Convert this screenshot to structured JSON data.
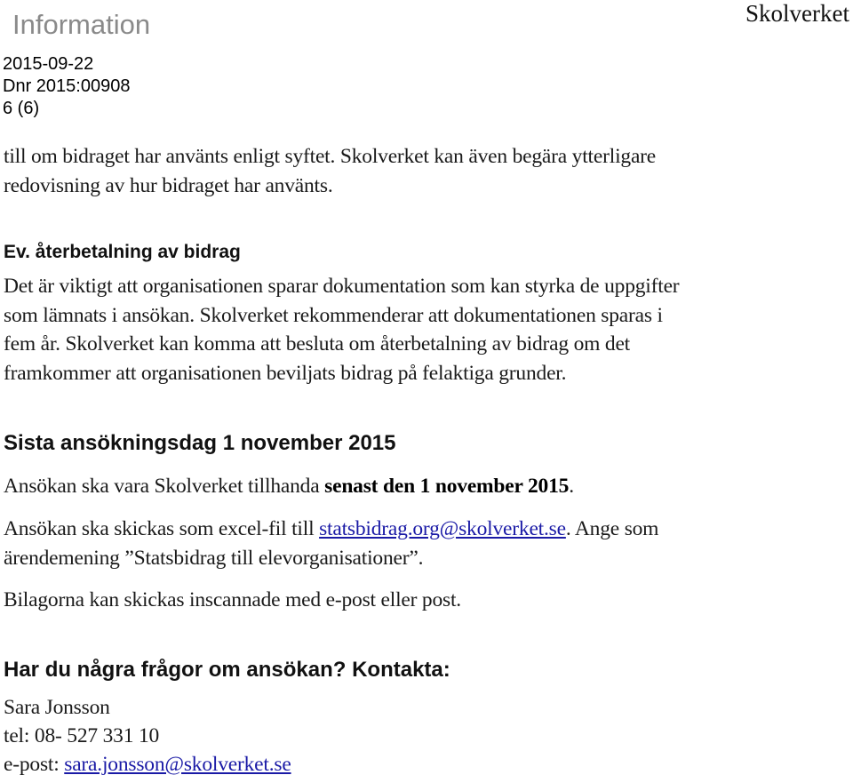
{
  "header": {
    "doc_type": "Information",
    "org_name": "Skolverket",
    "date": "2015-09-22",
    "dnr": "Dnr 2015:00908",
    "page": "6 (6)"
  },
  "intro": {
    "line1": "till om bidraget har använts enligt syftet. Skolverket kan även begära ytterligare",
    "line2": "redovisning av hur bidraget har använts."
  },
  "repayment": {
    "heading": "Ev. återbetalning av bidrag",
    "lines": [
      "Det är viktigt att organisationen sparar dokumentation som kan styrka de uppgifter",
      "som lämnats i ansökan. Skolverket rekommenderar att dokumentationen sparas i",
      "fem år. Skolverket kan komma att besluta om återbetalning av bidrag om det",
      "framkommer att organisationen beviljats bidrag på felaktiga grunder."
    ]
  },
  "deadline": {
    "heading": "Sista ansökningsdag 1 november 2015",
    "p1_prefix": "Ansökan ska vara Skolverket tillhanda ",
    "p1_bold": "senast den 1 november 2015",
    "p1_suffix": ".",
    "p2_prefix": "Ansökan ska skickas som excel-fil till ",
    "p2_link": "statsbidrag.org@skolverket.se",
    "p2_suffix": ". Ange som",
    "p2_line2": "ärendemening ”Statsbidrag till elevorganisationer”.",
    "p3": "Bilagorna kan skickas inscannade med e-post eller post."
  },
  "contact": {
    "heading": "Har du några frågor om ansökan? Kontakta:",
    "name": "Sara Jonsson",
    "phone": "tel: 08- 527 331 10",
    "email_label": "e-post: ",
    "email": "sara.jonsson@skolverket.se"
  },
  "colors": {
    "link": "#1a1aa6",
    "doc_type": "#8a8a8a",
    "text": "#111111"
  }
}
